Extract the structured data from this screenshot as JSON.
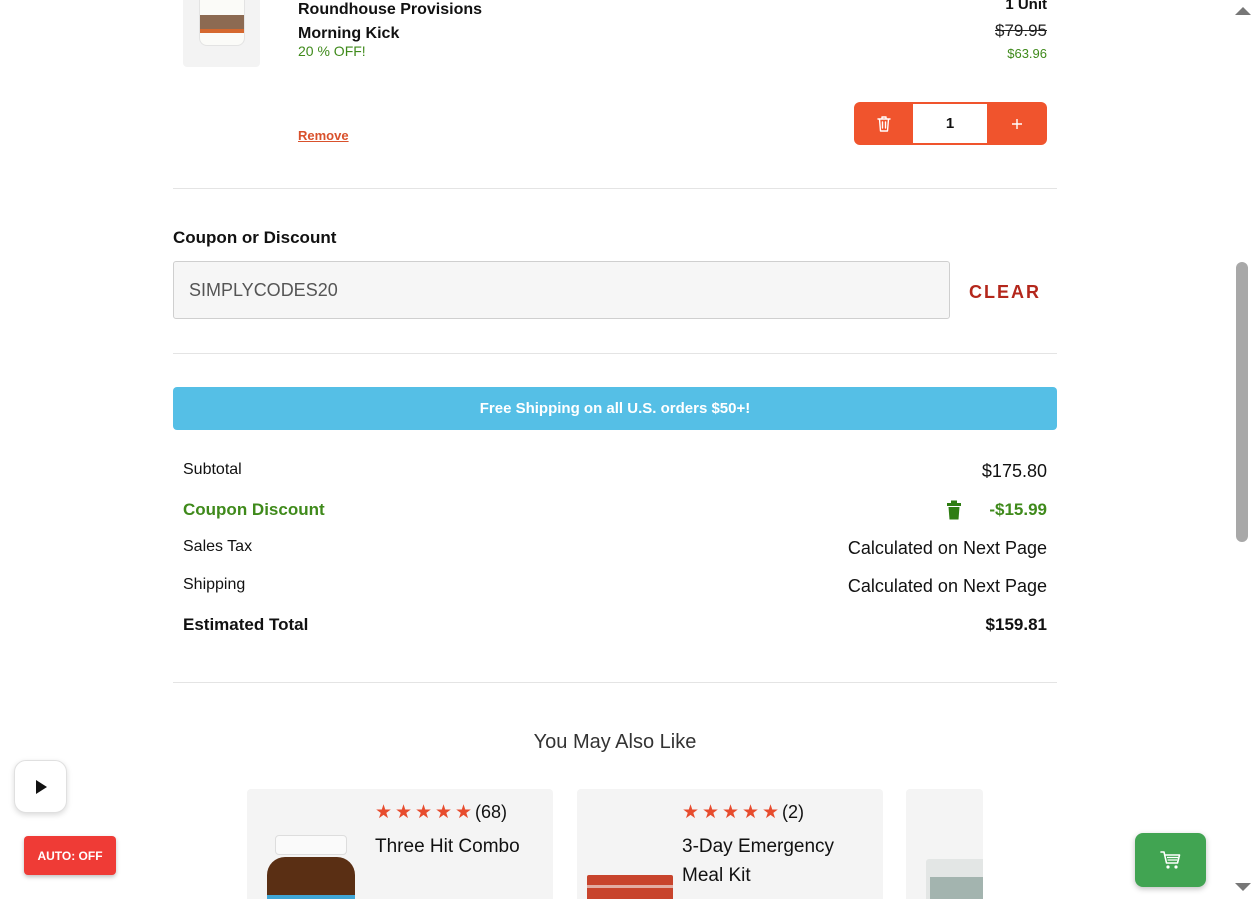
{
  "cart_item": {
    "name": "Roundhouse Provisions Morning Kick",
    "discount_label": "20 % OFF!",
    "units": "1 Unit",
    "original_price": "$79.95",
    "sale_price": "$63.96",
    "remove_label": "Remove",
    "quantity": "1",
    "trash_icon": "trash-icon",
    "plus_icon": "plus-icon"
  },
  "coupon": {
    "label": "Coupon or Discount",
    "value": "SIMPLYCODES20",
    "clear_label": "CLEAR"
  },
  "banner": {
    "text": "Free Shipping on all U.S. orders $50+!",
    "color": "#55bfe6"
  },
  "summary": {
    "subtotal_label": "Subtotal",
    "subtotal_value": "$175.80",
    "coupon_label": "Coupon Discount",
    "coupon_value": "-$15.99",
    "tax_label": "Sales Tax",
    "tax_value": "Calculated on Next Page",
    "shipping_label": "Shipping",
    "shipping_value": "Calculated on Next Page",
    "total_label": "Estimated Total",
    "total_value": "$159.81"
  },
  "recommendations": {
    "title": "You May Also Like",
    "items": [
      {
        "name": "Three Hit Combo",
        "rating_count": "(68)",
        "stars": 5
      },
      {
        "name": "3-Day Emergency Meal Kit",
        "rating_count": "(2)",
        "stars": 5
      }
    ]
  },
  "widgets": {
    "auto_label": "AUTO: OFF",
    "play_icon": "play-icon",
    "cart_icon": "cart-icon"
  },
  "colors": {
    "accent_orange": "#f0542d",
    "discount_green": "#3f8a1b",
    "clear_red": "#b4271b",
    "cart_green": "#41a452"
  }
}
